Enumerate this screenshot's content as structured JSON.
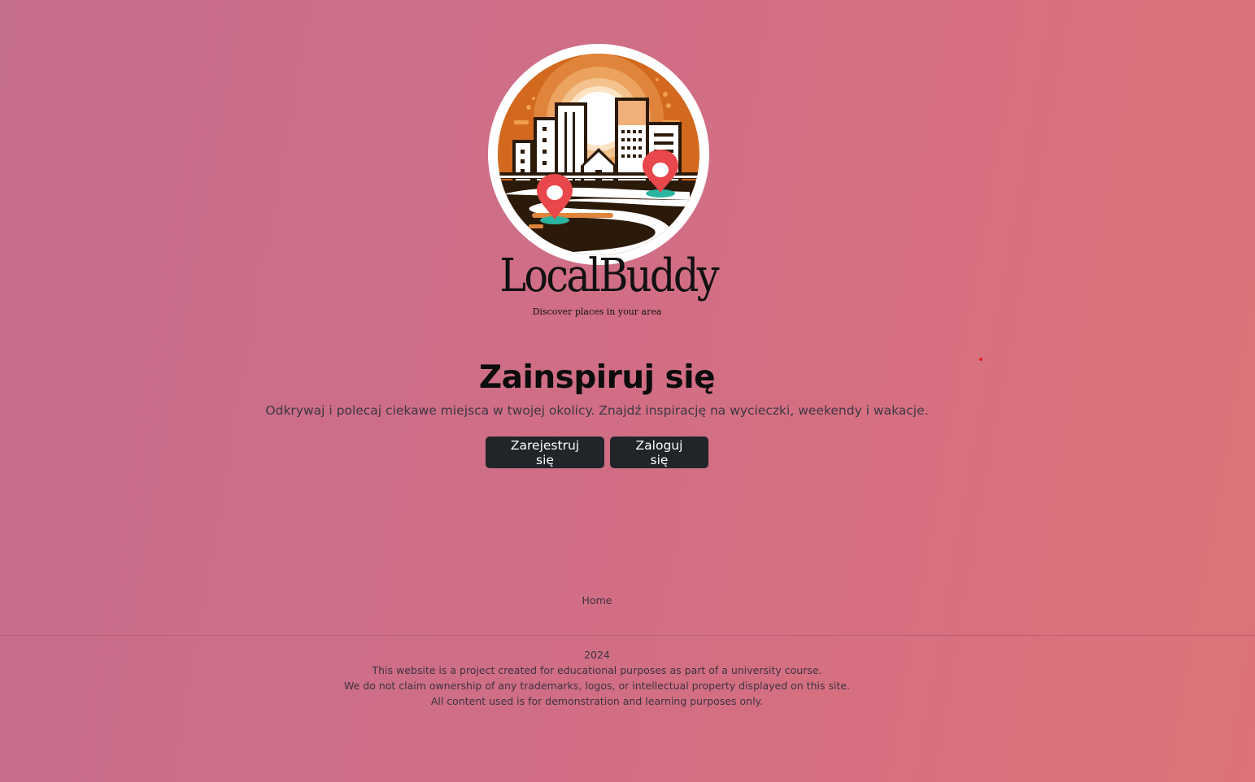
{
  "brand": {
    "name": "LocalBuddy",
    "tagline": "Discover places in your area"
  },
  "hero": {
    "title": "Zainspiruj się",
    "subtitle": "Odkrywaj i polecaj ciekawe miejsca w twojej okolicy. Znajdź inspirację na wycieczki, weekendy i wakacje.",
    "register_label": "Zarejestruj się",
    "login_label": "Zaloguj się"
  },
  "footer": {
    "nav_home": "Home",
    "year": "2024",
    "lines": [
      "This website is a project created for educational purposes as part of a university course.",
      "We do not claim ownership of any trademarks, logos, or intellectual property displayed on this site.",
      "All content used is for demonstration and learning purposes only."
    ]
  },
  "colors": {
    "button_bg": "#212529",
    "button_text": "#ffffff",
    "background_start": "#c56d8d",
    "background_end": "#dd7279",
    "logo_orange": "#d2691e",
    "logo_dark": "#2b1a0a",
    "pin_red": "#e8474b",
    "pin_teal": "#2bb5a0"
  },
  "icons": {
    "logo": "city-skyline-map-pin-logo"
  }
}
